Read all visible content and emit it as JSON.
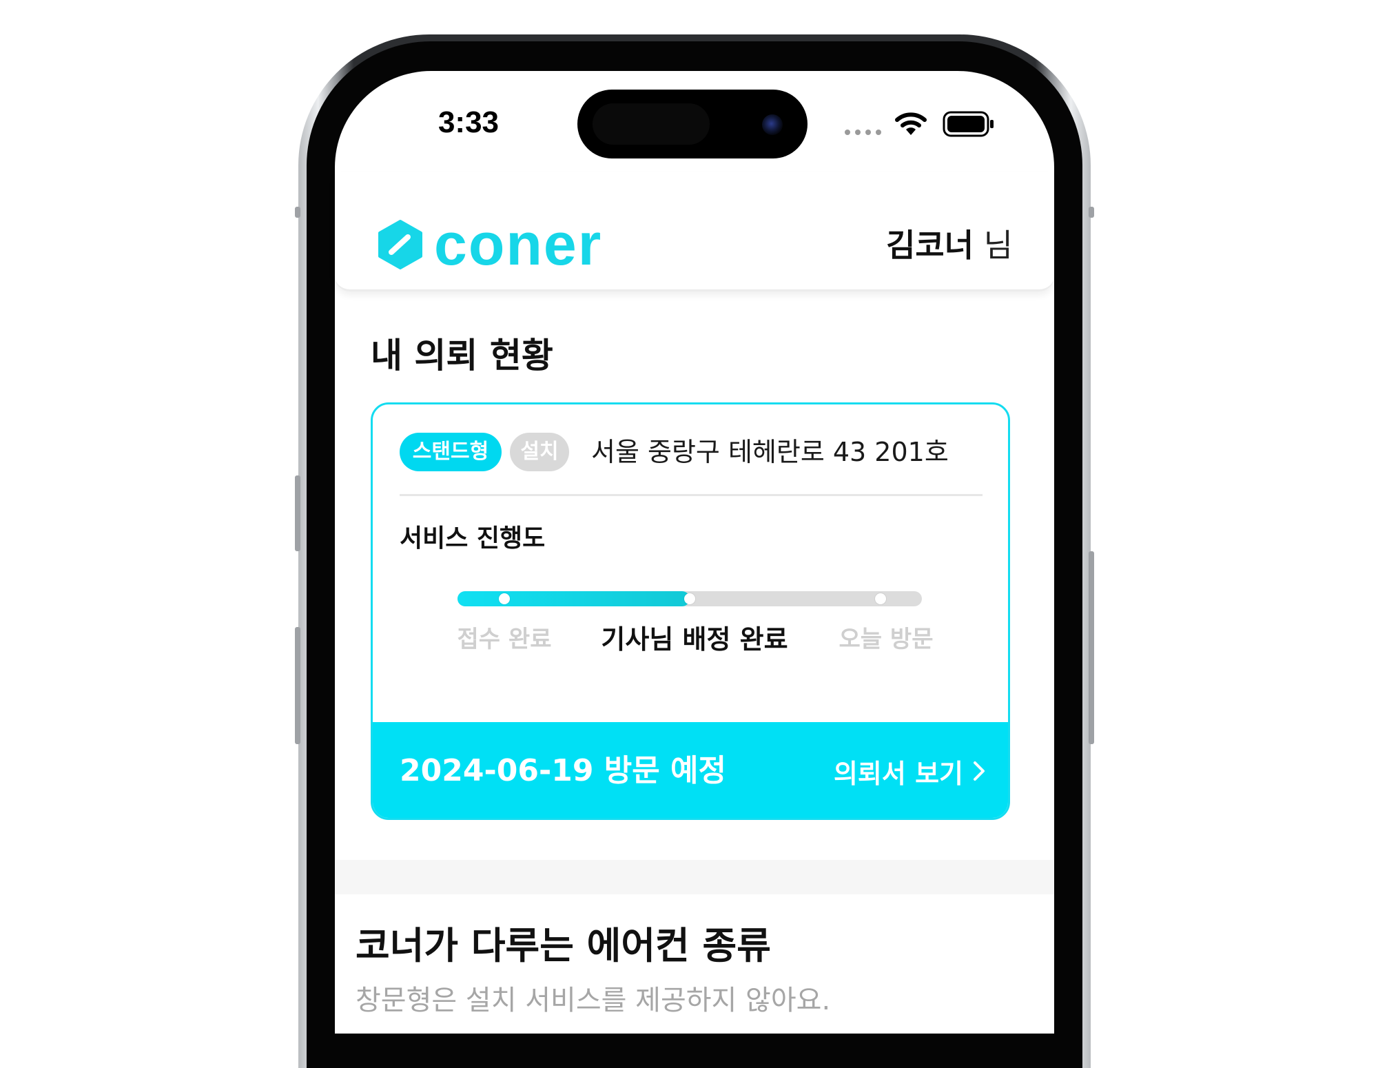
{
  "status_bar": {
    "time": "3:33",
    "icons": [
      "signal-dots-icon",
      "wifi-icon",
      "battery-icon"
    ]
  },
  "header": {
    "logo_text": "coner",
    "user_name": "김코너",
    "user_suffix": "님"
  },
  "request_status": {
    "title": "내 의뢰 현황",
    "card": {
      "badges": [
        "스탠드형",
        "설치"
      ],
      "address": "서울 중랑구 테헤란로 43 201호",
      "progress_title": "서비스 진행도",
      "progress_fraction": 0.5,
      "steps": [
        {
          "label": "접수 완료",
          "state": "done"
        },
        {
          "label": "기사님 배정 완료",
          "state": "current"
        },
        {
          "label": "오늘 방문",
          "state": "todo"
        }
      ],
      "visit_date": "2024-06-19 방문 예정",
      "view_request_label": "의뢰서 보기"
    }
  },
  "aircon_types": {
    "title": "코너가 다루는 에어컨 종류",
    "subtitle": "창문형은 설치 서비스를 제공하지 않아요."
  },
  "colors": {
    "brand": "#17d6e8",
    "accent": "#00e0f5",
    "badge_muted": "#d9d9d9"
  }
}
